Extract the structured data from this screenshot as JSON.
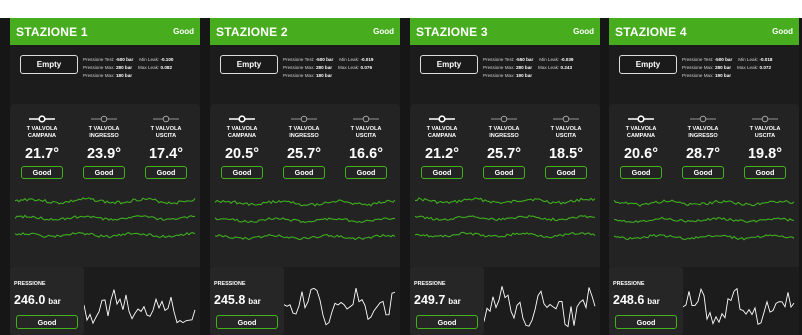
{
  "stations": [
    {
      "title": "STAZIONE 1",
      "status": "Good",
      "empty_label": "Empty",
      "pressure_test_label": "Pressione Test:",
      "pressure_test": "-500 bar",
      "min_leak_label": "Min Leak:",
      "min_leak": "-0.100",
      "pressure_max_label": "Pressione Max:",
      "pressure_max": "280 bar",
      "max_leak_label": "Max Leak:",
      "max_leak": "0.082",
      "pressure_max2": "180 bar",
      "sensors": [
        {
          "label": "T VALVOLA\nCAMPANA",
          "value": "21.7°",
          "status": "Good"
        },
        {
          "label": "T VALVOLA\nINGRESSO",
          "value": "23.9°",
          "status": "Good"
        },
        {
          "label": "T VALVOLA\nUSCITA",
          "value": "17.4°",
          "status": "Good"
        }
      ],
      "pressure_label": "PRESSIONE",
      "pressure_value": "246.0",
      "pressure_unit": "bar",
      "pressure_status": "Good"
    },
    {
      "title": "STAZIONE 2",
      "status": "Good",
      "empty_label": "Empty",
      "pressure_test_label": "Pressione Test:",
      "pressure_test": "-500 bar",
      "min_leak_label": "Min Leak:",
      "min_leak": "-0.019",
      "pressure_max_label": "Pressione Max:",
      "pressure_max": "280 bar",
      "max_leak_label": "Max Leak:",
      "max_leak": "0.076",
      "pressure_max2": "180 bar",
      "sensors": [
        {
          "label": "T VALVOLA\nCAMPANA",
          "value": "20.5°",
          "status": "Good"
        },
        {
          "label": "T VALVOLA\nINGRESSO",
          "value": "25.7°",
          "status": "Good"
        },
        {
          "label": "T VALVOLA\nUSCITA",
          "value": "16.6°",
          "status": "Good"
        }
      ],
      "pressure_label": "PRESSIONE",
      "pressure_value": "245.8",
      "pressure_unit": "bar",
      "pressure_status": "Good"
    },
    {
      "title": "STAZIONE 3",
      "status": "Good",
      "empty_label": "Empty",
      "pressure_test_label": "Pressione Test:",
      "pressure_test": "-550 bar",
      "min_leak_label": "Min Leak:",
      "min_leak": "-0.039",
      "pressure_max_label": "Pressione Max:",
      "pressure_max": "280 bar",
      "max_leak_label": "Max Leak:",
      "max_leak": "0.243",
      "pressure_max2": "190 bar",
      "sensors": [
        {
          "label": "T VALVOLA\nCAMPANA",
          "value": "21.2°",
          "status": "Good"
        },
        {
          "label": "T VALVOLA\nINGRESSO",
          "value": "25.7°",
          "status": "Good"
        },
        {
          "label": "T VALVOLA\nUSCITA",
          "value": "18.5°",
          "status": "Good"
        }
      ],
      "pressure_label": "PRESSIONE",
      "pressure_value": "249.7",
      "pressure_unit": "bar",
      "pressure_status": "Good"
    },
    {
      "title": "STAZIONE 4",
      "status": "Good",
      "empty_label": "Empty",
      "pressure_test_label": "Pressione Test:",
      "pressure_test": "-500 bar",
      "min_leak_label": "Min Leak:",
      "min_leak": "-0.018",
      "pressure_max_label": "Pressione Max:",
      "pressure_max": "280 bar",
      "max_leak_label": "Max Leak:",
      "max_leak": "0.072",
      "pressure_max2": "190 bar",
      "sensors": [
        {
          "label": "T VALVOLA\nCAMPANA",
          "value": "20.6°",
          "status": "Good"
        },
        {
          "label": "T VALVOLA\nINGRESSO",
          "value": "28.7°",
          "status": "Good"
        },
        {
          "label": "T VALVOLA\nUSCITA",
          "value": "19.8°",
          "status": "Good"
        }
      ],
      "pressure_label": "PRESSIONE",
      "pressure_value": "248.6",
      "pressure_unit": "bar",
      "pressure_status": "Good"
    }
  ],
  "colors": {
    "header_green": "#47ad1f",
    "good_border": "#43b31c",
    "trend_line": "#3fae1f",
    "sparkline": "#ffffff",
    "background": "#161616"
  },
  "icons": {
    "valve": "valve-icon"
  }
}
